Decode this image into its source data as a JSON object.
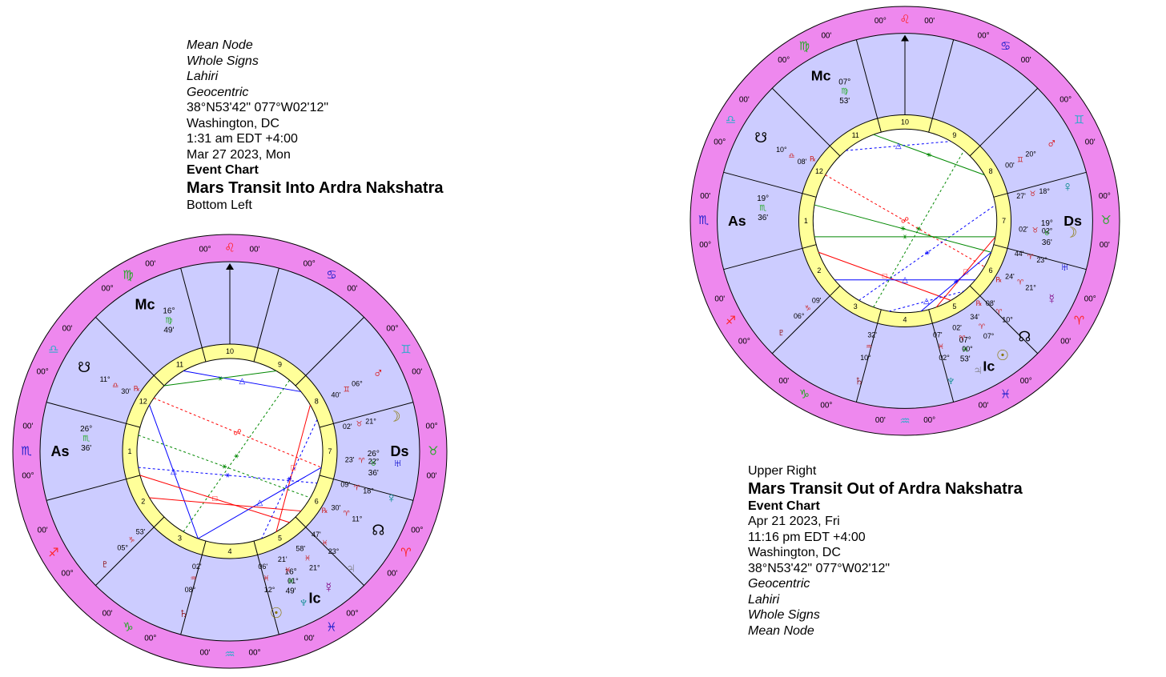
{
  "colors": {
    "zodiac_ring": "#ee88ee",
    "house_fill": "#ccccff",
    "inner_ring": "#ffff99",
    "aspect_red": "#ff0000",
    "aspect_blue": "#0000ff",
    "aspect_green": "#008800",
    "fire": "#ff2222",
    "earth": "#22aa22",
    "air": "#33aacc",
    "water": "#2222cc"
  },
  "left_chart": {
    "info": {
      "node": "Mean Node",
      "house_system": "Whole Signs",
      "ayanamsa": "Lahiri",
      "perspective": "Geocentric",
      "coords": "38°N53'42\" 077°W02'12\"",
      "place": "Washington, DC",
      "time": "1:31 am  EDT +4:00",
      "date": "Mar 27 2023, Mon",
      "type": "Event Chart",
      "title": "Mars Transit Into Ardra Nakshatra",
      "position_note": "Bottom Left"
    },
    "ring_labels": [
      "00°",
      "00'"
    ],
    "house_numbers": [
      "1",
      "2",
      "3",
      "4",
      "5",
      "6",
      "7",
      "8",
      "9",
      "10",
      "11",
      "12"
    ],
    "zodiac_glyphs": [
      "♌",
      "♋",
      "♊",
      "♉",
      "♈",
      "♓",
      "♒",
      "♑",
      "♐",
      "♏",
      "♎",
      "♍"
    ],
    "angles": [
      {
        "label": "As",
        "deg": "26°",
        "sign": "♏",
        "min": "36'"
      },
      {
        "label": "Mc",
        "deg": "16°",
        "sign": "♍",
        "min": "49'"
      },
      {
        "label": "Ds",
        "deg": "26°",
        "sign": "♉",
        "min": "36'"
      },
      {
        "label": "Ic",
        "deg": "16°",
        "sign": "♓",
        "min": "49'"
      }
    ],
    "planets": [
      {
        "glyph": "♂",
        "deg": "06°",
        "sign": "♊",
        "min": "40'",
        "retro": ""
      },
      {
        "glyph": "☽",
        "deg": "21°",
        "sign": "♉",
        "min": "02'",
        "retro": ""
      },
      {
        "glyph": "♅",
        "deg": "22°",
        "sign": "♈",
        "min": "23'",
        "retro": ""
      },
      {
        "glyph": "♀",
        "deg": "18°",
        "sign": "♈",
        "min": "09'",
        "retro": ""
      },
      {
        "glyph": "☊",
        "deg": "11°",
        "sign": "♈",
        "min": "30'",
        "retro": "℞"
      },
      {
        "glyph": "♃",
        "deg": "23°",
        "sign": "♓",
        "min": "47'",
        "retro": ""
      },
      {
        "glyph": "☿",
        "deg": "21°",
        "sign": "♓",
        "min": "58'",
        "retro": ""
      },
      {
        "glyph": "♆",
        "deg": "01°",
        "sign": "♓",
        "min": "21'",
        "retro": ""
      },
      {
        "glyph": "☉",
        "deg": "12°",
        "sign": "♓",
        "min": "06'",
        "retro": ""
      },
      {
        "glyph": "♄",
        "deg": "08°",
        "sign": "♒",
        "min": "02'",
        "retro": ""
      },
      {
        "glyph": "♇",
        "deg": "05°",
        "sign": "♑",
        "min": "53'",
        "retro": ""
      },
      {
        "glyph": "☋",
        "deg": "11°",
        "sign": "♎",
        "min": "30'",
        "retro": "℞"
      }
    ]
  },
  "right_chart": {
    "info": {
      "position_note": "Upper Right",
      "title": "Mars Transit Out of Ardra Nakshatra",
      "type": "Event Chart",
      "date": "Apr 21 2023, Fri",
      "time": "11:16 pm  EDT +4:00",
      "place": "Washington, DC",
      "coords": "38°N53'42\" 077°W02'12\"",
      "perspective": "Geocentric",
      "ayanamsa": "Lahiri",
      "house_system": "Whole Signs",
      "node": "Mean Node"
    },
    "angles": [
      {
        "label": "As",
        "deg": "19°",
        "sign": "♏",
        "min": "36'"
      },
      {
        "label": "Mc",
        "deg": "07°",
        "sign": "♍",
        "min": "53'"
      },
      {
        "label": "Ds",
        "deg": "19°",
        "sign": "♉",
        "min": "36'"
      },
      {
        "label": "Ic",
        "deg": "07°",
        "sign": "♓",
        "min": "53'"
      }
    ],
    "planets": [
      {
        "glyph": "♂",
        "deg": "20°",
        "sign": "♊",
        "min": "00'",
        "retro": ""
      },
      {
        "glyph": "♀",
        "deg": "18°",
        "sign": "♉",
        "min": "27'",
        "retro": ""
      },
      {
        "glyph": "☽",
        "deg": "02°",
        "sign": "♉",
        "min": "02'",
        "retro": ""
      },
      {
        "glyph": "♅",
        "deg": "23°",
        "sign": "♈",
        "min": "44'",
        "retro": ""
      },
      {
        "glyph": "☿",
        "deg": "21°",
        "sign": "♈",
        "min": "24'",
        "retro": "℞"
      },
      {
        "glyph": "☊",
        "deg": "10°",
        "sign": "♈",
        "min": "08'",
        "retro": "℞"
      },
      {
        "glyph": "☉",
        "deg": "07°",
        "sign": "♈",
        "min": "34'",
        "retro": ""
      },
      {
        "glyph": "♃",
        "deg": "00°",
        "sign": "♈",
        "min": "02'",
        "retro": ""
      },
      {
        "glyph": "♆",
        "deg": "02°",
        "sign": "♓",
        "min": "07'",
        "retro": ""
      },
      {
        "glyph": "♄",
        "deg": "10°",
        "sign": "♒",
        "min": "32'",
        "retro": ""
      },
      {
        "glyph": "♇",
        "deg": "06°",
        "sign": "♑",
        "min": "09'",
        "retro": ""
      },
      {
        "glyph": "☋",
        "deg": "10°",
        "sign": "♎",
        "min": "08'",
        "retro": "℞"
      }
    ]
  }
}
